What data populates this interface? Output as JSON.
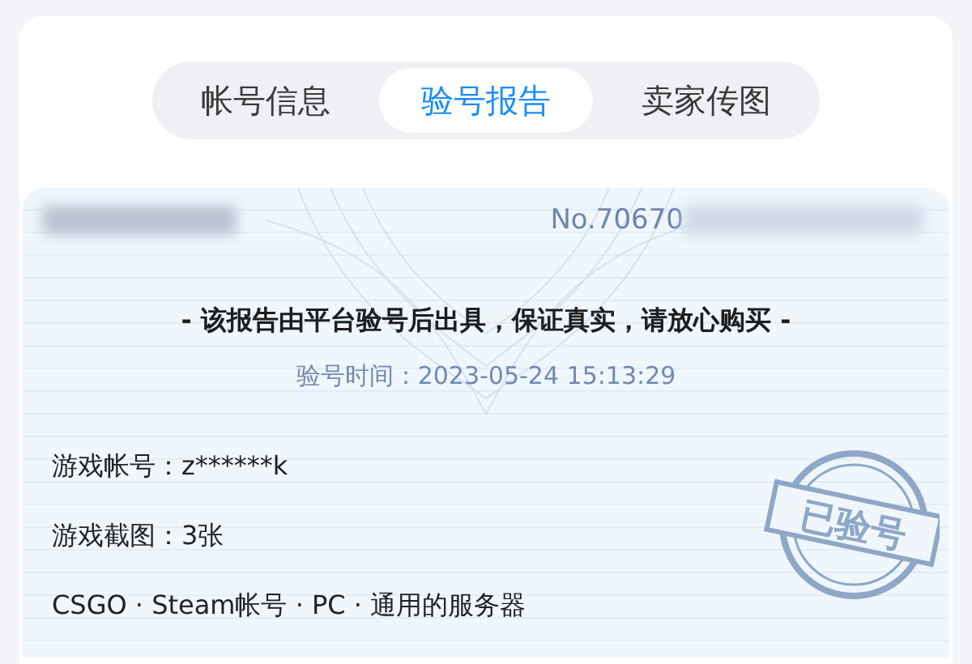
{
  "tabs": [
    {
      "label": "帐号信息",
      "selected": false
    },
    {
      "label": "验号报告",
      "selected": true
    },
    {
      "label": "卖家传图",
      "selected": false
    }
  ],
  "report": {
    "number": "No.70670",
    "notice": "- 该报告由平台验号后出具，保证真实，请放心购买 -",
    "time": "验号时间：2023-05-24 15:13:29",
    "details": [
      "游戏帐号：z******k",
      "游戏截图：3张",
      "CSGO · Steam帐号 · PC · 通用的服务器"
    ],
    "stamp": "已验号"
  }
}
